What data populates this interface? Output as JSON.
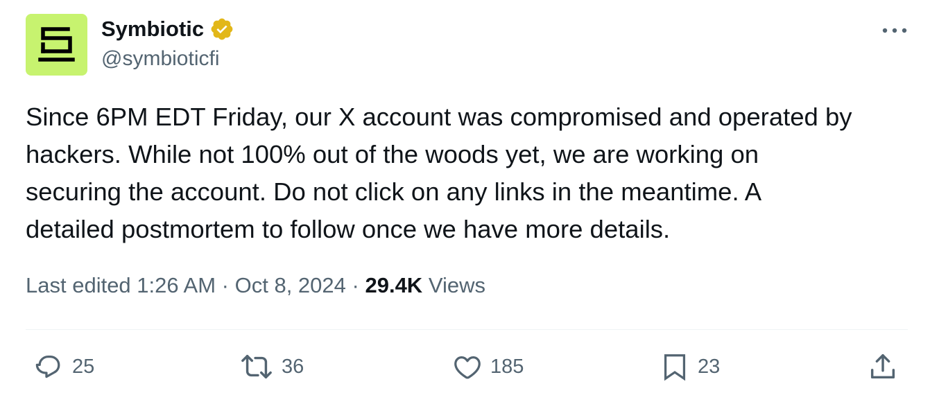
{
  "author": {
    "display_name": "Symbiotic",
    "handle": "@symbioticfi",
    "avatar_icon": "symbiotic-logo",
    "avatar_color": "#c7f36f",
    "verified_badge": "gold-verified-badge",
    "verified_color": "#e2b719"
  },
  "tweet": {
    "lines": [
      "Since 6PM EDT Friday, our X account was compromised and operated by",
      "hackers. While not 100% out of the woods yet, we are working on",
      "securing the account. Do not click on any links in the meantime. A",
      "detailed postmortem to follow once we have more details."
    ]
  },
  "meta": {
    "edited_time": "Last edited 1:26 AM",
    "separator": "·",
    "date": "Oct 8, 2024",
    "views_count": "29.4K",
    "views_label": "Views"
  },
  "actions": {
    "replies": "25",
    "reposts": "36",
    "likes": "185",
    "bookmarks": "23"
  },
  "icons": {
    "more": "more-dots-icon",
    "reply": "reply-icon",
    "repost": "repost-icon",
    "like": "heart-icon",
    "bookmark": "bookmark-icon",
    "share": "share-icon"
  },
  "colors": {
    "text": "#0f1419",
    "secondary": "#536471",
    "divider": "#eff3f4"
  }
}
